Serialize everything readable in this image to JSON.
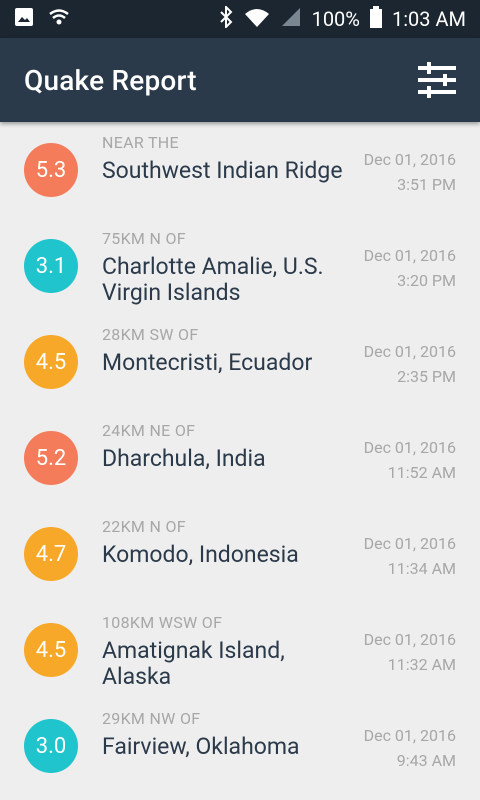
{
  "status_bar": {
    "battery_percent": "100%",
    "time": "1:03 AM",
    "icons": [
      "image-icon",
      "signal-icon",
      "bluetooth-icon",
      "wifi-icon",
      "cell-signal-icon",
      "battery-icon"
    ]
  },
  "app_bar": {
    "title": "Quake Report",
    "menu_icon": "filter-sliders-icon"
  },
  "quakes": [
    {
      "mag": "5.3",
      "offset": "NEAR THE",
      "place": "Southwest Indian Ridge",
      "date": "Dec 01, 2016",
      "time": "3:51 PM",
      "color": "#f47c5b"
    },
    {
      "mag": "3.1",
      "offset": "75KM N OF",
      "place": "Charlotte Amalie, U.S. Virgin Islands",
      "date": "Dec 01, 2016",
      "time": "3:20 PM",
      "color": "#1fc4cc"
    },
    {
      "mag": "4.5",
      "offset": "28KM SW OF",
      "place": "Montecristi, Ecuador",
      "date": "Dec 01, 2016",
      "time": "2:35 PM",
      "color": "#f7a828"
    },
    {
      "mag": "5.2",
      "offset": "24KM NE OF",
      "place": "Dharchula, India",
      "date": "Dec 01, 2016",
      "time": "11:52 AM",
      "color": "#f47c5b"
    },
    {
      "mag": "4.7",
      "offset": "22KM N OF",
      "place": "Komodo, Indonesia",
      "date": "Dec 01, 2016",
      "time": "11:34 AM",
      "color": "#f7a828"
    },
    {
      "mag": "4.5",
      "offset": "108KM WSW OF",
      "place": "Amatignak Island, Alaska",
      "date": "Dec 01, 2016",
      "time": "11:32 AM",
      "color": "#f7a828"
    },
    {
      "mag": "3.0",
      "offset": "29KM NW OF",
      "place": "Fairview, Oklahoma",
      "date": "Dec 01, 2016",
      "time": "9:43 AM",
      "color": "#1fc4cc"
    }
  ]
}
